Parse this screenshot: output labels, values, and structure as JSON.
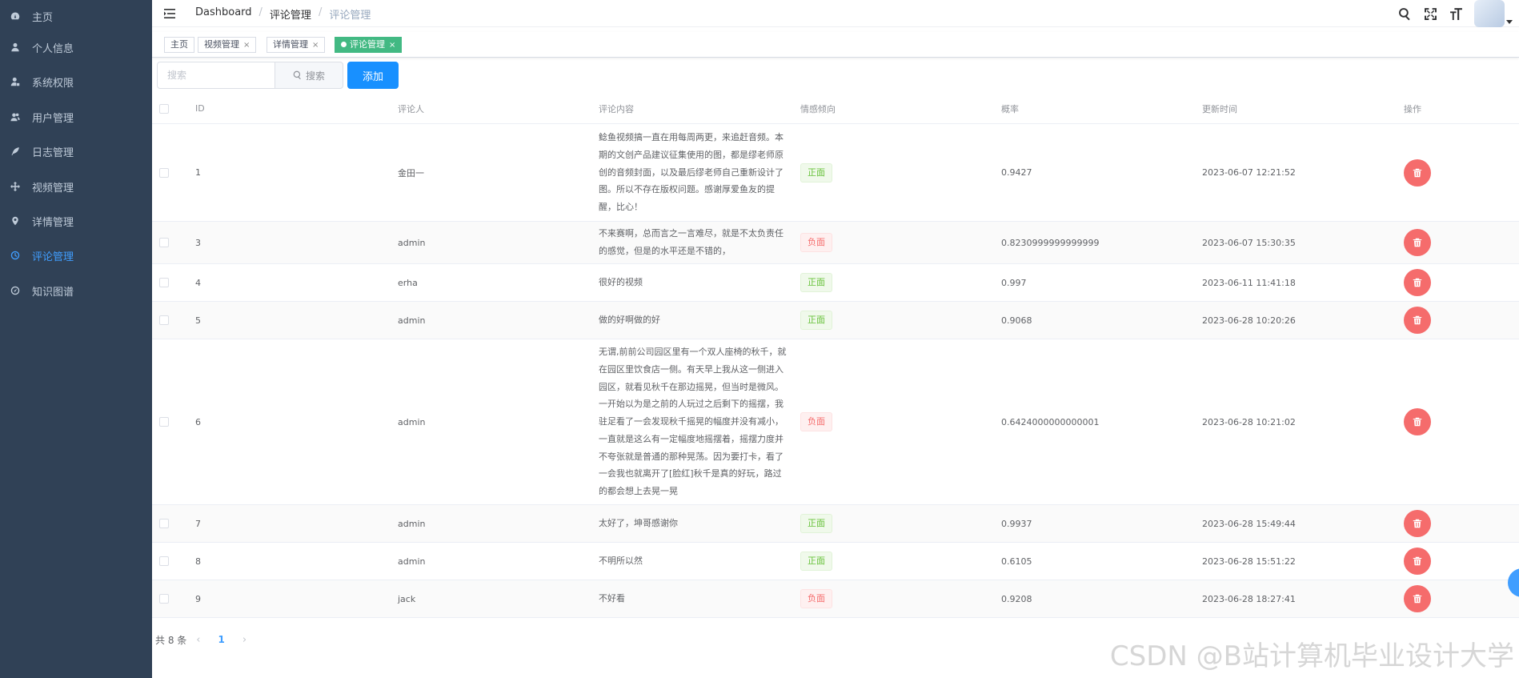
{
  "sidebar": {
    "items": [
      {
        "label": "主页",
        "icon": "dashboard-icon"
      },
      {
        "label": "个人信息",
        "icon": "user-icon"
      },
      {
        "label": "系统权限",
        "icon": "user-lock-icon"
      },
      {
        "label": "用户管理",
        "icon": "users-icon"
      },
      {
        "label": "日志管理",
        "icon": "feather-icon"
      },
      {
        "label": "视频管理",
        "icon": "move-icon"
      },
      {
        "label": "详情管理",
        "icon": "map-pin-icon"
      },
      {
        "label": "评论管理",
        "icon": "clock-icon"
      },
      {
        "label": "知识图谱",
        "icon": "gauge-icon"
      }
    ],
    "active_index": 7,
    "background": "#304156",
    "active_color": "#409eff"
  },
  "header": {
    "breadcrumb": [
      "Dashboard",
      "评论管理",
      "评论管理"
    ],
    "breadcrumb_sep": "/"
  },
  "tags": [
    {
      "label": "主页",
      "closable": false,
      "active": false
    },
    {
      "label": "视频管理",
      "closable": true,
      "active": false
    },
    {
      "label": "详情管理",
      "closable": true,
      "active": false
    },
    {
      "label": "评论管理",
      "closable": true,
      "active": true
    }
  ],
  "tag_close": "×",
  "search": {
    "placeholder": "搜索",
    "button_label": "搜索",
    "add_label": "添加"
  },
  "table": {
    "headers": [
      "ID",
      "评论人",
      "评论内容",
      "情感倾向",
      "概率",
      "更新时间",
      "操作"
    ],
    "rows": [
      {
        "id": "1",
        "user": "金田一",
        "content": "鲶鱼视频搞一直在用每周两更，来追赶音频。本期的文创产品建议征集使用的图，都是缪老师原创的音频封面，以及最后缪老师自己重新设计了图。所以不存在版权问题。感谢厚爱鱼友的提醒，比心！",
        "sentiment": "正面",
        "polarity": "pos",
        "prob": "0.9427",
        "time": "2023-06-07 12:21:52"
      },
      {
        "id": "3",
        "user": "admin",
        "content": "不来赛啊，总而言之一言难尽，就是不太负责任的感觉，但是的水平还是不错的，",
        "sentiment": "负面",
        "polarity": "neg",
        "prob": "0.8230999999999999",
        "time": "2023-06-07 15:30:35"
      },
      {
        "id": "4",
        "user": "erha",
        "content": "很好的视频",
        "sentiment": "正面",
        "polarity": "pos",
        "prob": "0.997",
        "time": "2023-06-11 11:41:18"
      },
      {
        "id": "5",
        "user": "admin",
        "content": "做的好啊做的好",
        "sentiment": "正面",
        "polarity": "pos",
        "prob": "0.9068",
        "time": "2023-06-28 10:20:26"
      },
      {
        "id": "6",
        "user": "admin",
        "content": "无谓,前前公司园区里有一个双人座椅的秋千，就在园区里饮食店一侧。有天早上我从这一侧进入园区，就看见秋千在那边摇晃，但当时是微风。一开始以为是之前的人玩过之后剩下的摇摆，我驻足看了一会发现秋千摇晃的幅度并没有减小，一直就是这么有一定幅度地摇摆着，摇摆力度并不夸张就是普通的那种晃荡。因为要打卡，看了一会我也就离开了[脸红]秋千是真的好玩，路过的都会想上去晃一晃",
        "sentiment": "负面",
        "polarity": "neg",
        "prob": "0.6424000000000001",
        "time": "2023-06-28 10:21:02"
      },
      {
        "id": "7",
        "user": "admin",
        "content": "太好了，坤哥感谢你",
        "sentiment": "正面",
        "polarity": "pos",
        "prob": "0.9937",
        "time": "2023-06-28 15:49:44"
      },
      {
        "id": "8",
        "user": "admin",
        "content": "不明所以然",
        "sentiment": "正面",
        "polarity": "pos",
        "prob": "0.6105",
        "time": "2023-06-28 15:51:22"
      },
      {
        "id": "9",
        "user": "jack",
        "content": "不好看",
        "sentiment": "负面",
        "polarity": "neg",
        "prob": "0.9208",
        "time": "2023-06-28 18:27:41"
      }
    ]
  },
  "pagination": {
    "total_text": "共 8 条",
    "current_page": "1",
    "prev": "‹",
    "next": "›"
  },
  "watermark": "CSDN @B站计算机毕业设计大学"
}
